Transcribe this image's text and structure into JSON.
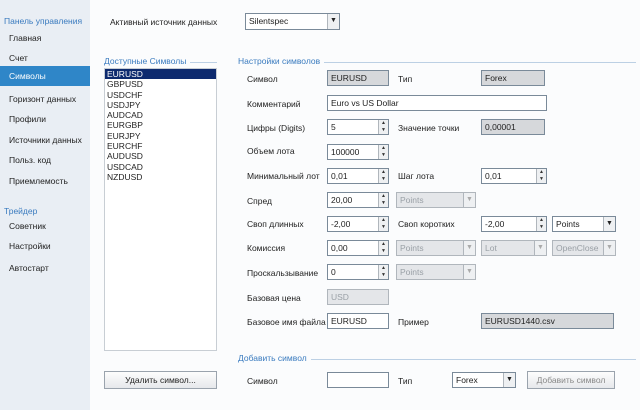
{
  "sidebar": {
    "group1": "Панель управления",
    "items1": [
      "Главная",
      "Счет",
      "Символы",
      "Горизонт данных",
      "Профили",
      "Источники данных",
      "Польз. код",
      "Приемлемость"
    ],
    "group2": "Трейдер",
    "items2": [
      "Советник",
      "Настройки",
      "Автостарт"
    ],
    "active": "Символы"
  },
  "source": {
    "label": "Активный источник данных",
    "value": "Silentspec"
  },
  "symbols_panel": {
    "title": "Доступные Символы",
    "list": [
      "EURUSD",
      "GBPUSD",
      "USDCHF",
      "USDJPY",
      "AUDCAD",
      "EURGBP",
      "EURJPY",
      "EURCHF",
      "AUDUSD",
      "USDCAD",
      "NZDUSD"
    ],
    "selected": "EURUSD",
    "delete_button": "Удалить символ..."
  },
  "settings": {
    "title": "Настройки символов",
    "symbol_label": "Символ",
    "symbol_value": "EURUSD",
    "type_label": "Тип",
    "type_value": "Forex",
    "comment_label": "Комментарий",
    "comment_value": "Euro vs US Dollar",
    "digits_label": "Цифры (Digits)",
    "digits_value": "5",
    "point_label": "Значение точки",
    "point_value": "0,00001",
    "lot_label": "Объем лота",
    "lot_value": "100000",
    "minlot_label": "Минимальный лот",
    "minlot_value": "0,01",
    "lotstep_label": "Шаг лота",
    "lotstep_value": "0,01",
    "spread_label": "Спред",
    "spread_value": "20,00",
    "spread_unit": "Points",
    "swaplong_label": "Своп длинных",
    "swaplong_value": "-2,00",
    "swapshort_label": "Своп коротких",
    "swapshort_value": "-2,00",
    "swapshort_unit": "Points",
    "commission_label": "Комиссия",
    "commission_value": "0,00",
    "commission_unit1": "Points",
    "commission_unit2": "Lot",
    "commission_unit3": "OpenClose",
    "slippage_label": "Проскальзывание",
    "slippage_value": "0",
    "slippage_unit": "Points",
    "basecur_label": "Базовая цена",
    "basecur_value": "USD",
    "basefile_label": "Базовое имя файла",
    "basefile_value": "EURUSD",
    "example_label": "Пример",
    "example_value": "EURUSD1440.csv"
  },
  "add": {
    "title": "Добавить символ",
    "symbol_label": "Символ",
    "symbol_value": "",
    "type_label": "Тип",
    "type_value": "Forex",
    "add_button": "Добавить символ"
  }
}
